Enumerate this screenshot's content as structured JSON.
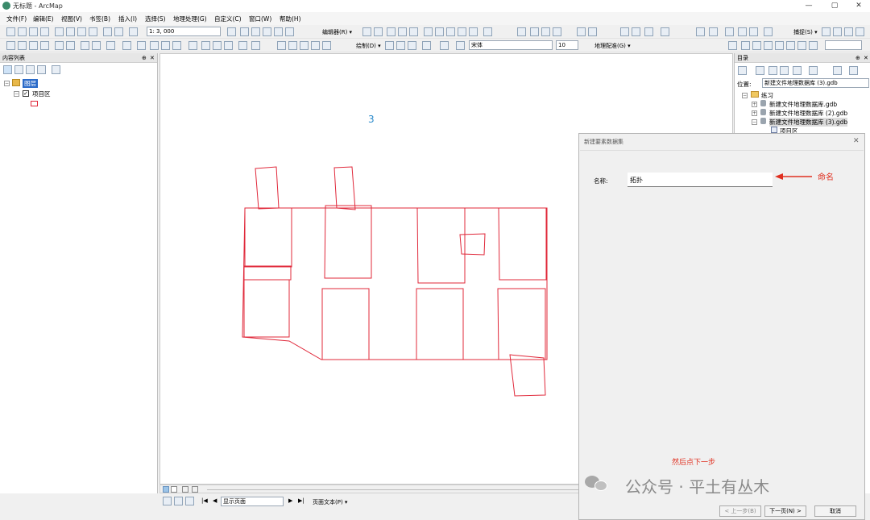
{
  "window": {
    "title": "无标题 - ArcMap",
    "controls": [
      "—",
      "▢",
      "✕"
    ]
  },
  "menu": [
    "文件(F)",
    "编辑(E)",
    "视图(V)",
    "书签(B)",
    "插入(I)",
    "选择(S)",
    "地理处理(G)",
    "自定义(C)",
    "窗口(W)",
    "帮助(H)"
  ],
  "toolbar": {
    "scale": "1: 3, 000",
    "editor": "编辑器(R) ▾",
    "snapping": "捕捉(S) ▾",
    "draw": "绘制(D) ▾",
    "font_name": "宋体",
    "font_size": "10",
    "georef": "地理配准(G) ▾"
  },
  "toc": {
    "title": "内容列表",
    "layers_root": "图层",
    "layer": "项目区"
  },
  "catalog": {
    "title": "目录",
    "location_label": "位置:",
    "location_value": "新建文件地理数据库 (3).gdb",
    "folder": "练习",
    "items": [
      "新建文件地理数据库.gdb",
      "新建文件地理数据库 (2).gdb",
      "新建文件地理数据库 (3).gdb"
    ],
    "sub_item": "项目区"
  },
  "map": {
    "label": "3",
    "bottom_combo": "显示页面",
    "page_text": "页面文本(P) ▾"
  },
  "dialog": {
    "title": "新建要素数据集",
    "name_label": "名称:",
    "name_value": "拓扑",
    "back_button": "< 上一步(B)",
    "next_button": "下一页(N) >",
    "cancel_button": "取消"
  },
  "annotations": {
    "naming": "命名",
    "then_next": "然后点下一步",
    "watermark": "公众号 · 平土有丛木"
  },
  "colors": {
    "annotation_red": "#e03020",
    "feature_red": "#e0283a",
    "label_blue": "#2a8acb"
  }
}
